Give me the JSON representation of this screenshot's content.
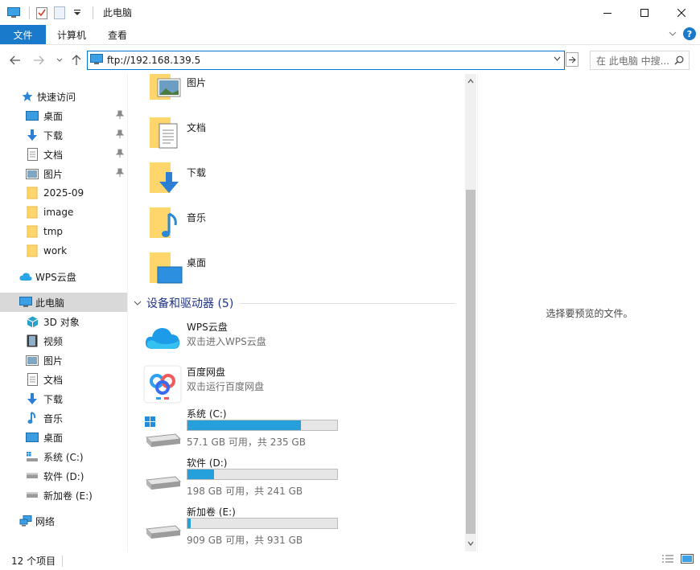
{
  "window": {
    "title": "此电脑"
  },
  "ribbon": {
    "tabs": [
      "文件",
      "计算机",
      "查看"
    ]
  },
  "address": {
    "path": "ftp://192.168.139.5",
    "search_placeholder": "在 此电脑 中搜..."
  },
  "sidebar": {
    "quick_access": "快速访问",
    "qa_items": [
      "桌面",
      "下载",
      "文档",
      "图片",
      "2025-09",
      "image",
      "tmp",
      "work"
    ],
    "wps": "WPS云盘",
    "this_pc": "此电脑",
    "pc_items": [
      "3D 对象",
      "视频",
      "图片",
      "文档",
      "下载",
      "音乐",
      "桌面",
      "系统 (C:)",
      "软件 (D:)",
      "新加卷 (E:)"
    ],
    "network": "网络"
  },
  "main": {
    "folders": [
      "图片",
      "文档",
      "下载",
      "音乐",
      "桌面"
    ],
    "group_title": "设备和驱动器 (5)",
    "cloud": [
      {
        "name": "WPS云盘",
        "desc": "双击进入WPS云盘"
      },
      {
        "name": "百度网盘",
        "desc": "双击运行百度网盘"
      }
    ],
    "drives": [
      {
        "name": "系统 (C:)",
        "info": "57.1 GB 可用，共 235 GB",
        "used_fraction": 0.757
      },
      {
        "name": "软件 (D:)",
        "info": "198 GB 可用，共 241 GB",
        "used_fraction": 0.178
      },
      {
        "name": "新加卷 (E:)",
        "info": "909 GB 可用，共 931 GB",
        "used_fraction": 0.024
      }
    ]
  },
  "preview": {
    "text": "选择要预览的文件。"
  },
  "status": {
    "items": "12 个项目"
  },
  "colors": {
    "accent": "#1979ca",
    "bar": "#26a0da",
    "group": "#1e3287"
  }
}
